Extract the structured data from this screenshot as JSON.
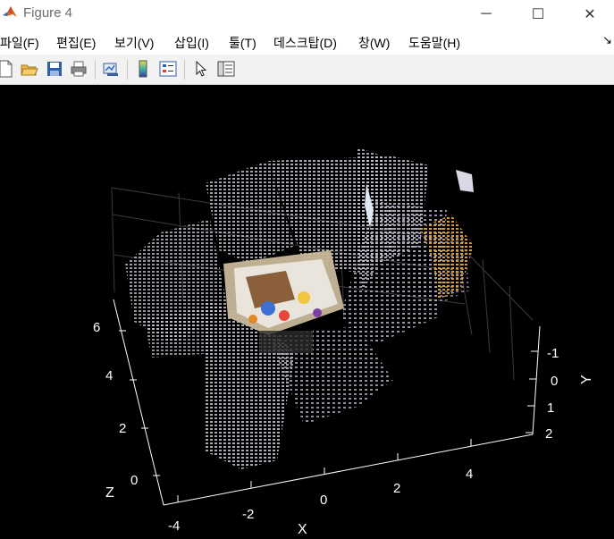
{
  "window": {
    "title": "Figure 4"
  },
  "window_controls": {
    "minimize": "─",
    "maximize": "☐",
    "close": "✕"
  },
  "menu": [
    {
      "label": "파일(F)"
    },
    {
      "label": "편집(E)"
    },
    {
      "label": "보기(V)"
    },
    {
      "label": "삽입(I)"
    },
    {
      "label": "툴(T)"
    },
    {
      "label": "데스크탑(D)"
    },
    {
      "label": "창(W)"
    },
    {
      "label": "도움말(H)"
    }
  ],
  "menu_overflow": "↘",
  "toolbar": [
    {
      "icon": "new-figure-icon"
    },
    {
      "icon": "open-file-icon"
    },
    {
      "icon": "save-icon"
    },
    {
      "icon": "print-icon"
    },
    {
      "icon": "link-plot-icon"
    },
    {
      "icon": "colorbar-icon"
    },
    {
      "icon": "legend-icon"
    },
    {
      "icon": "select-pointer-icon"
    },
    {
      "icon": "property-inspector-icon"
    }
  ],
  "axes": {
    "x": {
      "label": "X",
      "ticks": [
        "-4",
        "-2",
        "0",
        "2",
        "4"
      ]
    },
    "y": {
      "label": "Y",
      "ticks": [
        "-1",
        "0",
        "1",
        "2"
      ]
    },
    "z": {
      "label": "Z",
      "ticks": [
        "0",
        "2",
        "4",
        "6"
      ]
    }
  },
  "colors": {
    "background": "#000000",
    "axis": "#ffffff"
  }
}
